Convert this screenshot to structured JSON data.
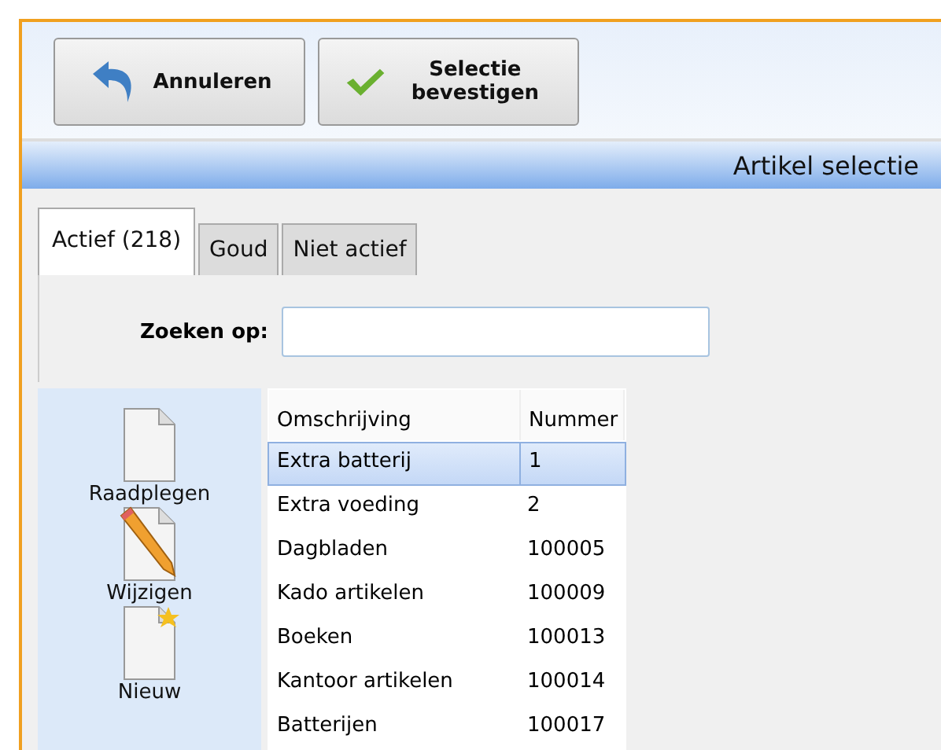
{
  "toolbar": {
    "buttons": [
      {
        "kind": "undo",
        "label": "Annuleren"
      },
      {
        "kind": "check",
        "label": "Selectie bevestigen"
      }
    ]
  },
  "header": {
    "title": "Artikel selectie"
  },
  "tabs": [
    {
      "label": "Actief (218)",
      "selected": true
    },
    {
      "label": "Goud",
      "selected": false
    },
    {
      "label": "Niet actief",
      "selected": false
    }
  ],
  "search": {
    "label": "Zoeken op:"
  },
  "sidebar": {
    "items": [
      {
        "kind": "view",
        "label": "Raadplegen"
      },
      {
        "kind": "edit",
        "label": "Wijzigen"
      },
      {
        "kind": "new",
        "label": "Nieuw"
      }
    ]
  },
  "table": {
    "columns": [
      "Omschrijving",
      "Nummer"
    ],
    "rows": [
      {
        "cells": [
          "Extra batterij",
          "1"
        ],
        "selected": true
      },
      {
        "cells": [
          "Extra voeding",
          "2"
        ],
        "selected": false
      },
      {
        "cells": [
          "Dagbladen",
          "100005"
        ],
        "selected": false
      },
      {
        "cells": [
          "Kado artikelen",
          "100009"
        ],
        "selected": false
      },
      {
        "cells": [
          "Boeken",
          "100013"
        ],
        "selected": false
      },
      {
        "cells": [
          "Kantoor artikelen",
          "100014"
        ],
        "selected": false
      },
      {
        "cells": [
          "Batterijen",
          "100017"
        ],
        "selected": false
      }
    ]
  }
}
